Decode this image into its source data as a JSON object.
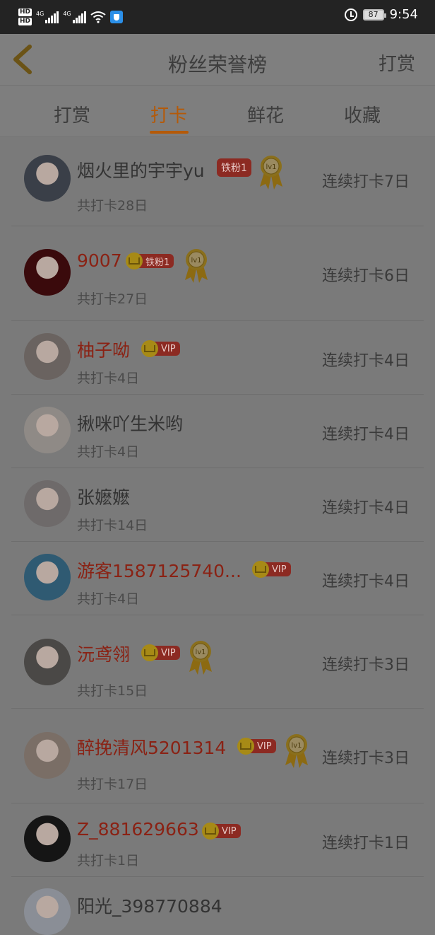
{
  "status_bar": {
    "time": "9:54",
    "battery": "87",
    "hd1": "HD",
    "hd2": "HD",
    "net1": "4G",
    "net2": "4G"
  },
  "header": {
    "title": "粉丝荣誉榜",
    "right_action": "打赏"
  },
  "tabs": [
    {
      "label": "打赏",
      "active": false
    },
    {
      "label": "打卡",
      "active": true
    },
    {
      "label": "鲜花",
      "active": false
    },
    {
      "label": "收藏",
      "active": false
    }
  ],
  "rows": [
    {
      "name": "烟火里的宇宇yu",
      "name_style": "normal",
      "fan_badge": "铁粉1",
      "crown_badge": null,
      "medal": "lv1",
      "total": "共打卡28日",
      "streak": "连续打卡7日",
      "avatar_color": "#3a3f48"
    },
    {
      "name": "9007",
      "name_style": "vip",
      "fan_badge": null,
      "crown_badge": "铁粉1",
      "medal": "lv1",
      "total": "共打卡27日",
      "streak": "连续打卡6日",
      "avatar_color": "#3a0a0c"
    },
    {
      "name": "柚子呦",
      "name_style": "vip",
      "fan_badge": null,
      "crown_badge": "VIP",
      "medal": null,
      "total": "共打卡4日",
      "streak": "连续打卡4日",
      "avatar_color": "#6a6360"
    },
    {
      "name": "揪咪吖生米哟",
      "name_style": "normal",
      "fan_badge": null,
      "crown_badge": null,
      "medal": null,
      "total": "共打卡4日",
      "streak": "连续打卡4日",
      "avatar_color": "#8f8a86"
    },
    {
      "name": "张嬷嬷",
      "name_style": "normal",
      "fan_badge": null,
      "crown_badge": null,
      "medal": null,
      "total": "共打卡14日",
      "streak": "连续打卡4日",
      "avatar_color": "#6e6a6a"
    },
    {
      "name": "游客1587125740...",
      "name_style": "vip",
      "fan_badge": null,
      "crown_badge": "VIP",
      "medal": null,
      "total": "共打卡4日",
      "streak": "连续打卡4日",
      "avatar_color": "#2f5a72"
    },
    {
      "name": "沅鸢翎",
      "name_style": "vip",
      "fan_badge": null,
      "crown_badge": "VIP",
      "medal": "lv1",
      "total": "共打卡15日",
      "streak": "连续打卡3日",
      "avatar_color": "#4a4846"
    },
    {
      "name": "醉挽清风5201314",
      "name_style": "vip",
      "fan_badge": null,
      "crown_badge": "VIP",
      "medal": "lv1",
      "total": "共打卡17日",
      "streak": "连续打卡3日",
      "avatar_color": "#7a6e66"
    },
    {
      "name": "Z_881629663",
      "name_style": "vip",
      "fan_badge": null,
      "crown_badge": "VIP",
      "medal": null,
      "total": "共打卡1日",
      "streak": "连续打卡1日",
      "avatar_color": "#151515"
    },
    {
      "name": "阳光_398770884",
      "name_style": "normal",
      "fan_badge": null,
      "crown_badge": null,
      "medal": null,
      "total": "",
      "streak": "",
      "avatar_color": "#8a8e96"
    }
  ]
}
